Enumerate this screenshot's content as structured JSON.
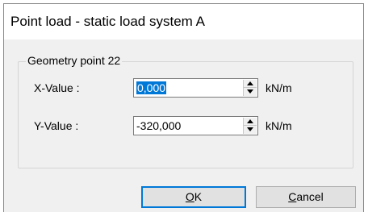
{
  "window": {
    "title": "Point load - static load system A"
  },
  "group": {
    "label": "Geometry point 22"
  },
  "fields": [
    {
      "label": "X-Value :",
      "value": "0,000",
      "unit": "kN/m",
      "selected": true
    },
    {
      "label": "Y-Value :",
      "value": "-320,000",
      "unit": "kN/m",
      "selected": false
    }
  ],
  "buttons": {
    "ok": {
      "mnemonic": "O",
      "rest": "K"
    },
    "cancel": {
      "mnemonic": "C",
      "rest": "ancel"
    }
  },
  "colors": {
    "selection": "#0078d7",
    "dialog_background": "#f0f0f0"
  },
  "icons": {
    "spinner_up": "arrow-up-icon",
    "spinner_down": "arrow-down-icon"
  }
}
